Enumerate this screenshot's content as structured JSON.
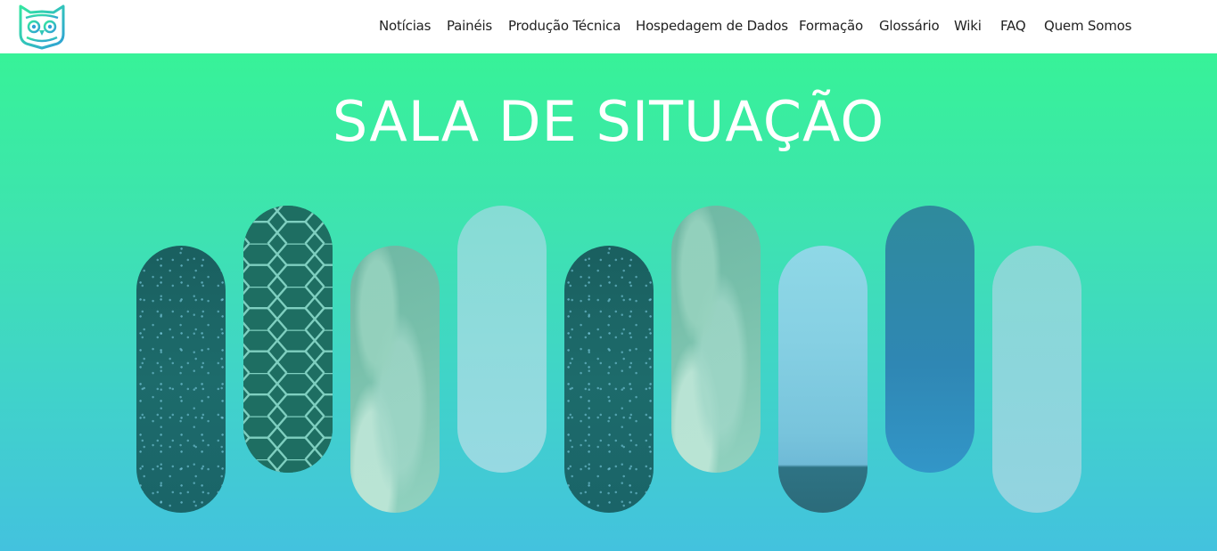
{
  "header": {
    "logo_icon": "owl-icon",
    "nav": [
      {
        "label": "Notícias"
      },
      {
        "label": "Painéis"
      },
      {
        "label": "Produção Técnica"
      },
      {
        "label": "Hospedagem de Dados"
      },
      {
        "label": "Formação"
      },
      {
        "label": "Glossário"
      },
      {
        "label": "Wiki"
      },
      {
        "label": "FAQ"
      },
      {
        "label": "Quem Somos"
      }
    ]
  },
  "hero": {
    "title": "SALA DE SITUAÇÃO",
    "gradient_colors": [
      "#37f298",
      "#43c2de"
    ],
    "pills": [
      {
        "image": "ocean-texture-image"
      },
      {
        "image": "hexagon-grid-image"
      },
      {
        "image": "coastline-aerial-image"
      },
      {
        "image": "light-teal-image"
      },
      {
        "image": "ocean-texture-image"
      },
      {
        "image": "coastline-aerial-image"
      },
      {
        "image": "sky-landscape-image"
      },
      {
        "image": "blue-gradient-image"
      },
      {
        "image": "pale-teal-image"
      }
    ]
  }
}
